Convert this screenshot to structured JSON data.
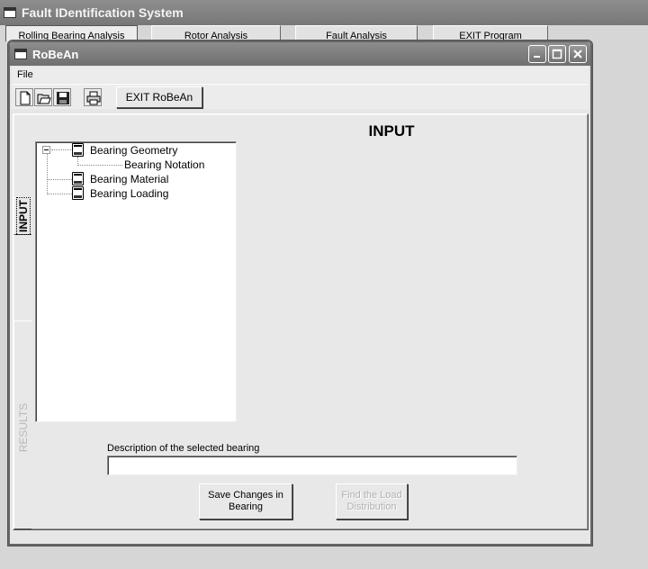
{
  "outer_app": {
    "title": "Fault IDentification System",
    "tabs": [
      "Rolling Bearing Analysis",
      "Rotor Analysis",
      "Fault Analysis",
      "EXIT Program"
    ]
  },
  "window": {
    "title": "RoBeAn"
  },
  "menu": {
    "items": [
      "File"
    ]
  },
  "toolbar": {
    "icons": [
      "new-file-icon",
      "open-folder-icon",
      "save-disk-icon",
      "print-icon"
    ],
    "exit_label": "EXIT RoBeAn"
  },
  "side_tabs": {
    "input": "INPUT",
    "results": "RESULTS"
  },
  "main": {
    "heading": "INPUT",
    "tree": {
      "root_label": "Bearing Geometry",
      "child_label": "Bearing Notation",
      "items": [
        "Bearing Material",
        "Bearing Loading"
      ]
    },
    "description_label": "Description of the selected bearing",
    "description_value": "",
    "save_label": "Save Changes in Bearing",
    "find_label": "Find the Load Distribution"
  },
  "colors": {
    "titlebar": "#777777",
    "window_bg": "#e6e6e6"
  }
}
